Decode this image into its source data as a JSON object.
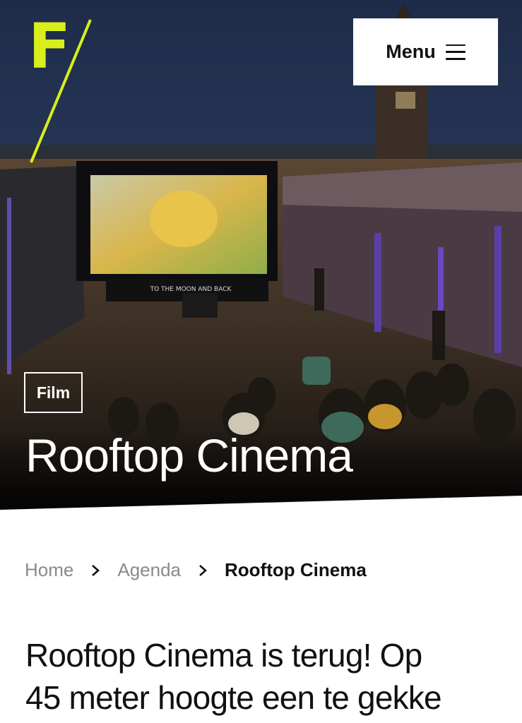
{
  "header": {
    "logo_letter": "F",
    "menu_label": "Menu"
  },
  "hero": {
    "category": "Film",
    "title": "Rooftop Cinema",
    "screen_text": "TO THE MOON AND BACK"
  },
  "breadcrumb": {
    "items": [
      "Home",
      "Agenda"
    ],
    "current": "Rooftop Cinema"
  },
  "intro": {
    "line1": "Rooftop Cinema is terug! Op",
    "line2": "45 meter hoogte een te gekke"
  },
  "colors": {
    "accent": "#d8ef1c",
    "text": "#111111",
    "muted": "#8a8a8a"
  }
}
